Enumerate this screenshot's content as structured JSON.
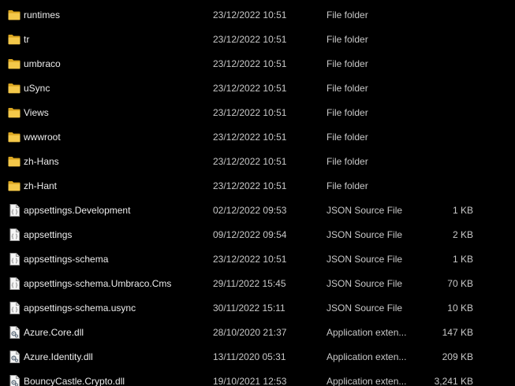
{
  "files": [
    {
      "name": "runtimes",
      "date": "23/12/2022 10:51",
      "type": "File folder",
      "size": "",
      "icon": "folder-icon"
    },
    {
      "name": "tr",
      "date": "23/12/2022 10:51",
      "type": "File folder",
      "size": "",
      "icon": "folder-icon"
    },
    {
      "name": "umbraco",
      "date": "23/12/2022 10:51",
      "type": "File folder",
      "size": "",
      "icon": "folder-icon"
    },
    {
      "name": "uSync",
      "date": "23/12/2022 10:51",
      "type": "File folder",
      "size": "",
      "icon": "folder-icon"
    },
    {
      "name": "Views",
      "date": "23/12/2022 10:51",
      "type": "File folder",
      "size": "",
      "icon": "folder-icon"
    },
    {
      "name": "wwwroot",
      "date": "23/12/2022 10:51",
      "type": "File folder",
      "size": "",
      "icon": "folder-icon"
    },
    {
      "name": "zh-Hans",
      "date": "23/12/2022 10:51",
      "type": "File folder",
      "size": "",
      "icon": "folder-icon"
    },
    {
      "name": "zh-Hant",
      "date": "23/12/2022 10:51",
      "type": "File folder",
      "size": "",
      "icon": "folder-icon"
    },
    {
      "name": "appsettings.Development",
      "date": "02/12/2022 09:53",
      "type": "JSON Source File",
      "size": "1 KB",
      "icon": "json-file-icon"
    },
    {
      "name": "appsettings",
      "date": "09/12/2022 09:54",
      "type": "JSON Source File",
      "size": "2 KB",
      "icon": "json-file-icon"
    },
    {
      "name": "appsettings-schema",
      "date": "23/12/2022 10:51",
      "type": "JSON Source File",
      "size": "1 KB",
      "icon": "json-file-icon"
    },
    {
      "name": "appsettings-schema.Umbraco.Cms",
      "date": "29/11/2022 15:45",
      "type": "JSON Source File",
      "size": "70 KB",
      "icon": "json-file-icon"
    },
    {
      "name": "appsettings-schema.usync",
      "date": "30/11/2022 15:11",
      "type": "JSON Source File",
      "size": "10 KB",
      "icon": "json-file-icon"
    },
    {
      "name": "Azure.Core.dll",
      "date": "28/10/2020 21:37",
      "type": "Application exten...",
      "size": "147 KB",
      "icon": "dll-file-icon"
    },
    {
      "name": "Azure.Identity.dll",
      "date": "13/11/2020 05:31",
      "type": "Application exten...",
      "size": "209 KB",
      "icon": "dll-file-icon"
    },
    {
      "name": "BouncyCastle.Crypto.dll",
      "date": "19/10/2021 12:53",
      "type": "Application exten...",
      "size": "3,241 KB",
      "icon": "dll-file-icon"
    }
  ],
  "colors": {
    "background": "#000000",
    "text": "#ececec",
    "secondary_text": "#c8c8c8",
    "folder": "#f4c84a",
    "folder_dark": "#d9a520"
  }
}
